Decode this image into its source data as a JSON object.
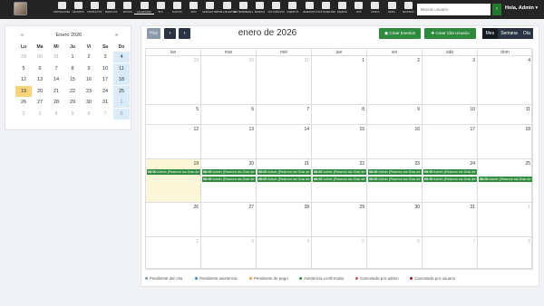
{
  "topbar": {
    "nav_items": [
      {
        "label": "HABITACIONES",
        "icon": "grid-icon"
      },
      {
        "label": "USUARIOS",
        "icon": "users-icon"
      },
      {
        "label": "PRODUCTOS",
        "icon": "box-icon"
      },
      {
        "label": "SERVICIOS",
        "icon": "wrench-icon"
      },
      {
        "label": "EXTRAS",
        "icon": "star-icon"
      },
      {
        "label": "CALENDARIO",
        "icon": "calendar-icon"
      },
      {
        "label": "BUS",
        "icon": "bus-icon"
      },
      {
        "label": "FURGOS",
        "icon": "van-icon"
      },
      {
        "label": "INFO",
        "icon": "info-icon"
      },
      {
        "label": "NEWSLETTER",
        "icon": "mail-icon"
      },
      {
        "label": "TABLA MAESTRA",
        "icon": "table-icon"
      },
      {
        "label": "SEPTIEMBRE/BAJAS",
        "icon": "list-icon"
      },
      {
        "label": "PEDIDOS",
        "icon": "cart-icon"
      },
      {
        "label": "FACTURACIÓN",
        "icon": "invoice-icon"
      },
      {
        "label": "CREDITOS",
        "icon": "credit-icon"
      },
      {
        "label": "RESERVAS",
        "icon": "booking-icon"
      },
      {
        "label": "CITAS TRABAJADOR",
        "icon": "briefcase-icon"
      },
      {
        "label": "BANEOS",
        "icon": "ban-icon"
      },
      {
        "label": "CMS",
        "icon": "pencil-icon"
      },
      {
        "label": "CONFIG",
        "icon": "gear-icon"
      },
      {
        "label": "MEDIA",
        "icon": "media-icon"
      },
      {
        "label": "SESIONES",
        "icon": "sessions-icon"
      }
    ],
    "active_index": 5,
    "search_placeholder": "Buscar usuario",
    "search_button": "›",
    "greeting": "Hola, Admin ▾"
  },
  "mini_calendar": {
    "title": "Enero 2026",
    "prev": "«",
    "next": "»",
    "weekdays": [
      "Lu",
      "Ma",
      "Mi",
      "Ju",
      "Vi",
      "Sa",
      "Do"
    ],
    "weeks": [
      [
        "29",
        "30",
        "31",
        "1",
        "2",
        "3",
        "4"
      ],
      [
        "5",
        "6",
        "7",
        "8",
        "9",
        "10",
        "11"
      ],
      [
        "12",
        "13",
        "14",
        "15",
        "16",
        "17",
        "18"
      ],
      [
        "19",
        "20",
        "21",
        "22",
        "23",
        "24",
        "25"
      ],
      [
        "26",
        "27",
        "28",
        "29",
        "30",
        "31",
        "1"
      ],
      [
        "2",
        "3",
        "4",
        "5",
        "6",
        "7",
        "8"
      ]
    ]
  },
  "calendar": {
    "title": "enero de 2026",
    "today_button": "Hoy",
    "prev": "‹",
    "next": "›",
    "create_event_button": "Crear Eventos",
    "create_appointment_button": "Crear Cita Usuario",
    "views": [
      "Mes",
      "Semana",
      "Día"
    ],
    "weekdays": [
      "lun",
      "mar",
      "mié",
      "jue",
      "vie",
      "sáb",
      "dom"
    ],
    "weeks": [
      [
        "29",
        "30",
        "31",
        "1",
        "2",
        "3",
        "4"
      ],
      [
        "5",
        "6",
        "7",
        "8",
        "9",
        "10",
        "11"
      ],
      [
        "12",
        "13",
        "14",
        "15",
        "16",
        "17",
        "18"
      ],
      [
        "19",
        "20",
        "21",
        "22",
        "23",
        "24",
        "25"
      ],
      [
        "26",
        "27",
        "28",
        "29",
        "30",
        "31",
        "1"
      ],
      [
        "2",
        "3",
        "4",
        "5",
        "6",
        "7",
        "8"
      ]
    ],
    "events_row1": [
      {
        "time": "08:00",
        "text": "Admin (Reserva tus Días de Surf en Origuena (Autorizado)"
      },
      {
        "time": "08:00",
        "text": "Admin (Reserva tus Días de Surf en Origuena (Autorizado)"
      },
      {
        "time": "08:00",
        "text": "Admin (Reserva tus Días de Surf en Origuena (Autorizado)"
      },
      {
        "time": "08:00",
        "text": "Admin (Reserva tus Días de Surf en Origuena (Autorizado)"
      },
      {
        "time": "08:00",
        "text": "Admin (Reserva tus Días de Surf en Origuena (Autorizado)"
      },
      {
        "time": "08:00",
        "text": "Admin (Reserva tus Días de Surf en Origuena (Autorizado)"
      }
    ],
    "events_row2": [
      {
        "time": "08:00",
        "text": "Admin (Reserva tus Días de Surf en Origuena (Autorizado)"
      },
      {
        "time": "08:00",
        "text": "Admin (Reserva tus Días de Surf en Origuena (Autorizado)"
      },
      {
        "time": "08:00",
        "text": "Admin (Reserva tus Días de Surf en Origuena (Autorizado)"
      },
      {
        "time": "08:00",
        "text": "Admin (Reserva tus Días de Surf en Origuena (Autorizado)"
      },
      {
        "time": "08:00",
        "text": "Admin (Reserva tus Días de Surf en Origuena (Autorizado)"
      },
      {
        "time": "08:00",
        "text": "Admin (Reserva tus Días de Surf en Origuena (Autorizado)"
      }
    ]
  },
  "legend": [
    {
      "label": "Pendiente dar cita",
      "color": "#8a9aa8"
    },
    {
      "label": "Pendiente asistencia",
      "color": "#3b82c4"
    },
    {
      "label": "Pendiente de pago",
      "color": "#e8a23a"
    },
    {
      "label": "Asistencia confirmada",
      "color": "#2e8b3d"
    },
    {
      "label": "Cancelada por admin",
      "color": "#d9534f"
    },
    {
      "label": "Cancelada por usuario",
      "color": "#8b1a1a"
    }
  ]
}
